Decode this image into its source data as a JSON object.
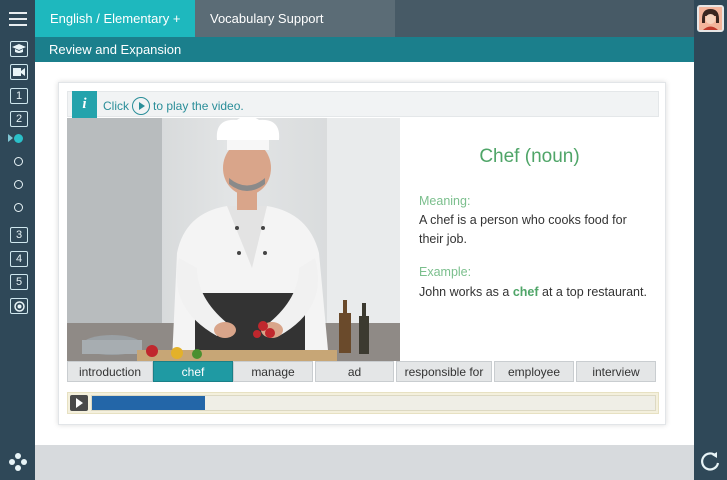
{
  "tabs": {
    "course": "English / Elementary +",
    "vocab": "Vocabulary Support"
  },
  "section_title": "Review and Expansion",
  "rail": {
    "units": [
      "1",
      "2",
      "3",
      "4",
      "5"
    ]
  },
  "info": {
    "icon_letter": "i",
    "click_text": "Click",
    "play_text": "to play the video."
  },
  "definition": {
    "word": "Chef (noun)",
    "meaning_label": "Meaning:",
    "meaning_text": "A chef is a person who cooks food for their job.",
    "example_label": "Example:",
    "example_before": "John works as a",
    "example_highlight": "chef",
    "example_after": "at a top restaurant."
  },
  "word_tabs": [
    "introduction",
    "chef",
    "manage",
    "ad",
    "responsible for",
    "employee",
    "interview"
  ],
  "active_word_tab": 1,
  "player": {
    "progress": 0.2
  },
  "icons": {
    "menu": "hamburger-menu-icon",
    "graduation": "graduation-cap-icon",
    "video": "video-camera-icon",
    "target": "target-icon",
    "logo": "flower-logo-icon",
    "avatar": "user-avatar-icon",
    "refresh": "refresh-icon",
    "info": "info-icon",
    "play": "play-icon"
  },
  "colors": {
    "teal": "#1eb8be",
    "dark_teal": "#1b7f8c",
    "navy": "#2f4858",
    "green": "#4fa568",
    "progress": "#2366a8"
  }
}
